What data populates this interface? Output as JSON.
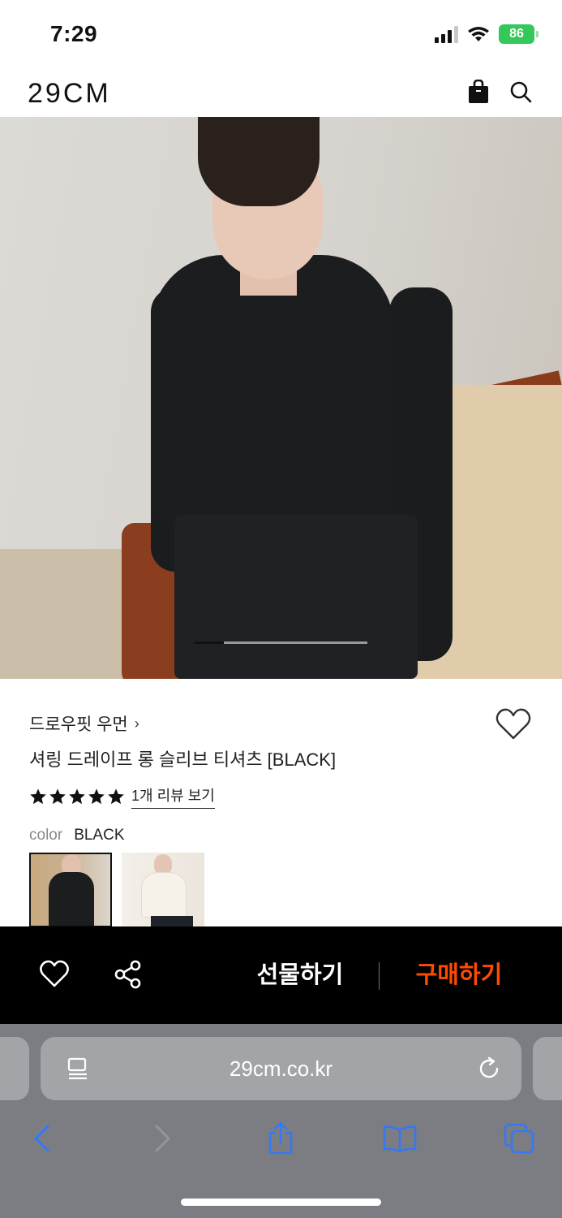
{
  "status_bar": {
    "time": "7:29",
    "battery": "86"
  },
  "header": {
    "logo": "29CM"
  },
  "product": {
    "brand": "드로우핏 우먼",
    "brand_chevron": "›",
    "name": "셔링 드레이프 롱 슬리브 티셔츠 [BLACK]",
    "rating_stars": 5,
    "review_link": "1개 리뷰 보기",
    "color_label": "color",
    "color_value": "BLACK",
    "swatches": [
      "BLACK",
      "CREAM"
    ]
  },
  "carousel": {
    "current": 1,
    "progress": 0.17
  },
  "action_bar": {
    "gift_label": "선물하기",
    "buy_label": "구매하기"
  },
  "browser": {
    "url": "29cm.co.kr"
  },
  "colors": {
    "accent": "#ff4b00",
    "bar_bg": "#000000",
    "battery": "#34c759"
  }
}
